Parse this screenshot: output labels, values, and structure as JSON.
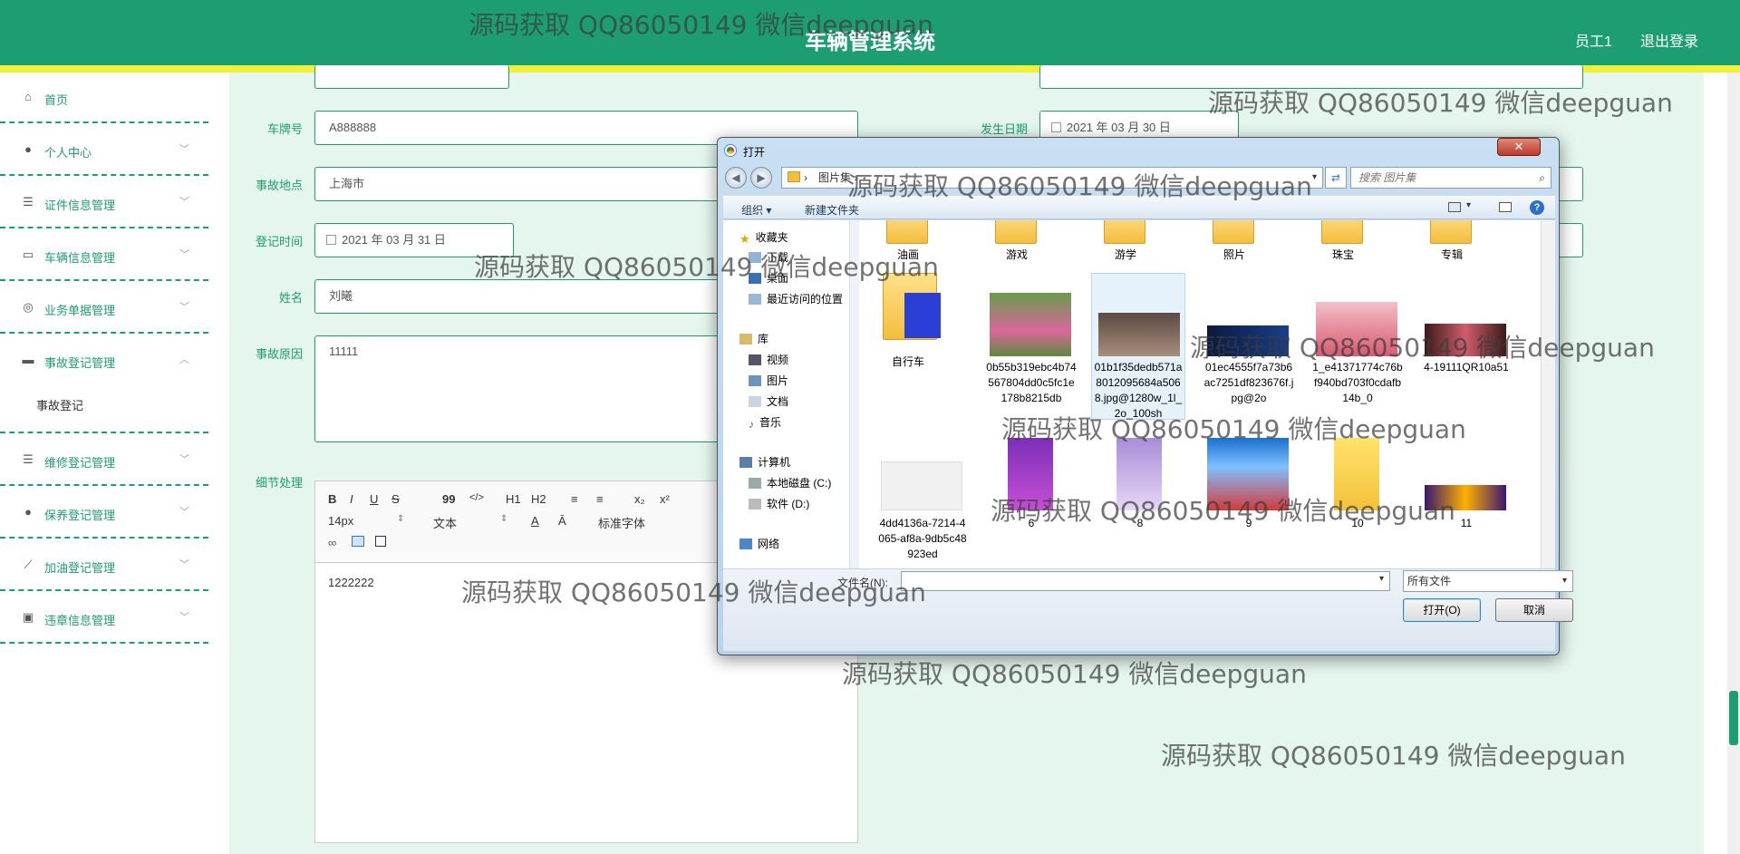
{
  "header": {
    "title": "车辆管理系统",
    "user": "员工1",
    "logout": "退出登录"
  },
  "colors": {
    "primary": "#1d9e72",
    "accent_bar": "#f0ef3a",
    "main_bg": "#e4f6ee"
  },
  "sidebar": {
    "items": [
      {
        "label": "首页",
        "icon": "home-icon"
      },
      {
        "label": "个人中心",
        "icon": "user-icon"
      },
      {
        "label": "证件信息管理",
        "icon": "list-icon"
      },
      {
        "label": "车辆信息管理",
        "icon": "message-icon"
      },
      {
        "label": "业务单据管理",
        "icon": "compass-icon"
      },
      {
        "label": "事故登记管理",
        "icon": "chat-icon"
      },
      {
        "label": "维修登记管理",
        "icon": "sliders-icon"
      },
      {
        "label": "保养登记管理",
        "icon": "user-icon"
      },
      {
        "label": "加油登记管理",
        "icon": "chart-icon"
      },
      {
        "label": "违章信息管理",
        "icon": "clipboard-icon"
      }
    ],
    "sub_item": "事故登记"
  },
  "form": {
    "plate_label": "车牌号",
    "plate_value": "A888888",
    "date_label": "发生日期",
    "date_value": "2021 年 03 月 30 日",
    "place_label": "事故地点",
    "place_value": "上海市",
    "reg_label": "登记时间",
    "reg_value": "2021 年 03 月 31 日",
    "name_label": "姓名",
    "name_value": "刘曦",
    "reason_label": "事故原因",
    "reason_value": "11111",
    "detail_label": "细节处理",
    "editor": {
      "font_size": "14px",
      "para": "文本",
      "font": "标准字体",
      "content": "1222222",
      "buttons": [
        "B",
        "I",
        "U",
        "S",
        "99",
        "</>",
        "H1",
        "H2",
        "≡",
        "≡",
        "x₂",
        "x²"
      ]
    }
  },
  "dialog": {
    "title": "打开",
    "address": "图片集",
    "search_placeholder": "搜索 图片集",
    "toolbar": {
      "organize": "组织 ▾",
      "new_folder": "新建文件夹"
    },
    "nav": {
      "favorites": "收藏夹",
      "downloads": "下载",
      "desktop": "桌面",
      "recent": "最近访问的位置",
      "library": "库",
      "video": "视频",
      "pictures": "图片",
      "docs": "文档",
      "music": "音乐",
      "computer": "计算机",
      "disk_c": "本地磁盘 (C:)",
      "disk_d": "软件 (D:)",
      "network": "网络"
    },
    "top_row": [
      "游戏",
      "游学",
      "照片",
      "珠宝",
      "专辑"
    ],
    "top_row_first": "油画",
    "files": [
      "自行车",
      "0b55b319ebc4b74567804dd0c5fc1e178b8215db",
      "01b1f35dedb571a8012095684a5068.jpg@1280w_1l_2o_100sh",
      "01ec4555f7a73b6ac7251df823676f.jpg@2o",
      "1_e41371774c76bf940bd703f0cdafb14b_0",
      "4-19111QR10a51",
      "4dd4136a-7214-4065-af8a-9db5c48923ed",
      "6",
      "8",
      "9",
      "10",
      "11"
    ],
    "filename_label": "文件名(N):",
    "filetype": "所有文件",
    "open_btn": "打开(O)",
    "cancel_btn": "取消"
  },
  "watermark": "源码获取 QQ86050149 微信deepguan"
}
